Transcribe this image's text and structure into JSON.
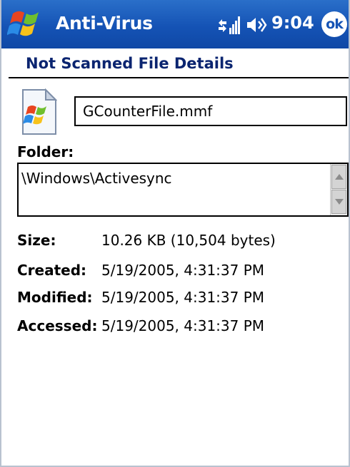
{
  "titlebar": {
    "app_title": "Anti-Virus",
    "clock": "9:04",
    "ok_label": "ok",
    "bar_color": "#1553b5"
  },
  "page": {
    "title": "Not Scanned File Details",
    "title_color": "#0a2470"
  },
  "file": {
    "name": "GCounterFile.mmf",
    "folder_label": "Folder:",
    "folder_path": "\\Windows\\Activesync"
  },
  "details": [
    {
      "label": "Size:",
      "value": "10.26 KB (10,504 bytes)"
    },
    {
      "label": "Created:",
      "value": "5/19/2005, 4:31:37 PM"
    },
    {
      "label": "Modified:",
      "value": "5/19/2005, 4:31:37 PM"
    },
    {
      "label": "Accessed:",
      "value": "5/19/2005, 4:31:37 PM"
    }
  ],
  "icons": {
    "start": "windows-flag-icon",
    "signal": "signal-strength-icon",
    "volume": "speaker-volume-icon",
    "file": "windows-file-icon"
  }
}
